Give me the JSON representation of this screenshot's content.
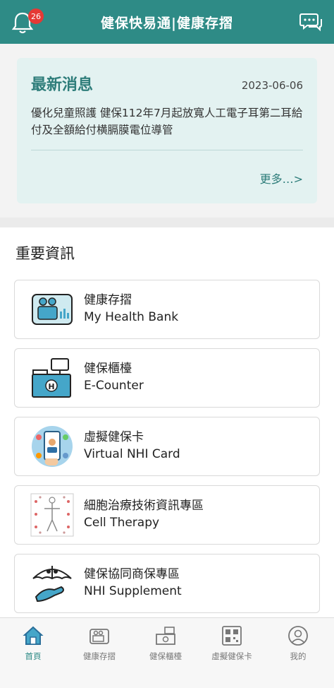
{
  "header": {
    "title": "健保快易通|健康存摺",
    "notification_count": "26"
  },
  "news": {
    "title": "最新消息",
    "date": "2023-06-06",
    "body": "優化兒童照護 健保112年7月起放寬人工電子耳第二耳給付及全額給付横膈膜電位導管",
    "more": "更多…>"
  },
  "section": {
    "title": "重要資訊"
  },
  "cards": [
    {
      "zh": "健康存摺",
      "en": "My Health Bank",
      "icon": "health-bank-icon"
    },
    {
      "zh": "健保櫃檯",
      "en": "E-Counter",
      "icon": "counter-icon"
    },
    {
      "zh": "虛擬健保卡",
      "en": "Virtual NHI Card",
      "icon": "virtual-card-icon"
    },
    {
      "zh": "細胞治療技術資訊專區",
      "en": "Cell Therapy",
      "icon": "cell-therapy-icon"
    },
    {
      "zh": "健保協同商保專區",
      "en": "NHI Supplement",
      "icon": "supplement-icon"
    }
  ],
  "nav": [
    {
      "label": "首頁",
      "icon": "home-icon",
      "active": true
    },
    {
      "label": "健康存摺",
      "icon": "health-bank-icon",
      "active": false
    },
    {
      "label": "健保櫃檯",
      "icon": "counter-icon",
      "active": false
    },
    {
      "label": "虛擬健保卡",
      "icon": "qr-card-icon",
      "active": false
    },
    {
      "label": "我的",
      "icon": "profile-icon",
      "active": false
    }
  ],
  "colors": {
    "primary": "#2e8b86",
    "news_bg": "#e3f2f1",
    "badge": "#e53935"
  }
}
